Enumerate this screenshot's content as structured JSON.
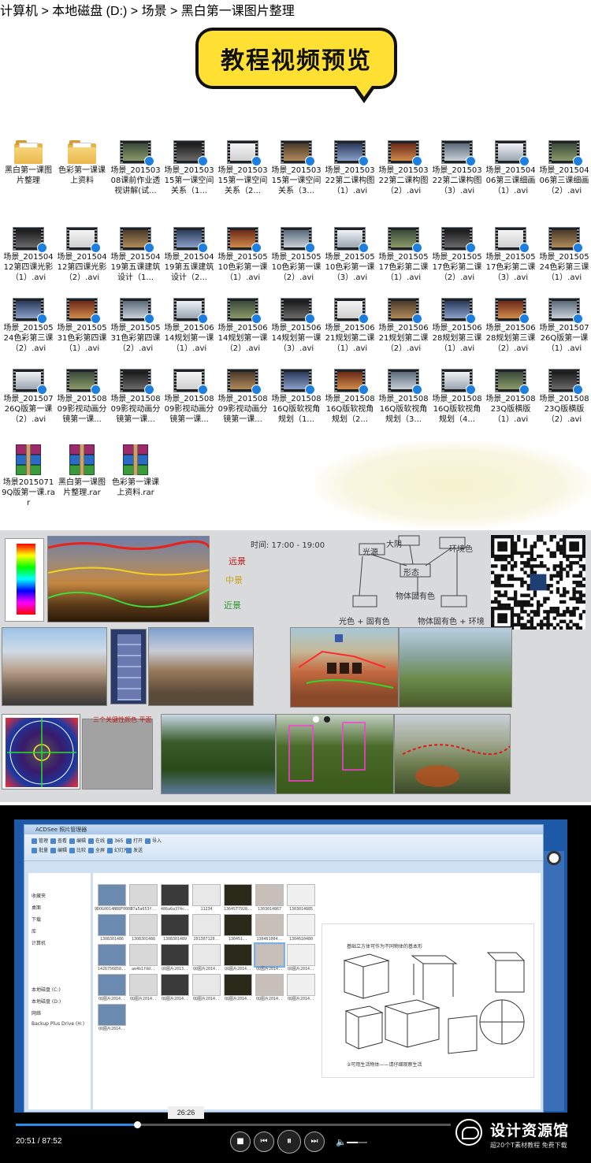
{
  "header": {
    "title": "教程视频预览"
  },
  "files": [
    {
      "label": "黑白第一课图片整理",
      "kind": "folder"
    },
    {
      "label": "色彩第一课课上资料",
      "kind": "folder"
    },
    {
      "label": "场景_20150308课前作业透视讲解(试...",
      "kind": "video"
    },
    {
      "label": "场景_20150315第一课空间关系（1...",
      "kind": "video"
    },
    {
      "label": "场景_20150315第一课空间关系（2...",
      "kind": "video"
    },
    {
      "label": "场景_20150315第一课空间关系（3...",
      "kind": "video"
    },
    {
      "label": "场景_20150322第二课构图（1）.avi",
      "kind": "video"
    },
    {
      "label": "场景_20150322第二课构图（2）.avi",
      "kind": "video"
    },
    {
      "label": "场景_20150322第二课构图（3）.avi",
      "kind": "video"
    },
    {
      "label": "场景_20150406第三课细画（1）.avi",
      "kind": "video"
    },
    {
      "label": "场景_20150406第三课细画（2）.avi",
      "kind": "video"
    },
    {
      "label": "场景_20150412第四课光影（1）.avi",
      "kind": "video"
    },
    {
      "label": "场景_20150412第四课光影（2）.avi",
      "kind": "video"
    },
    {
      "label": "场景_20150419第五课建筑设计（1...",
      "kind": "video"
    },
    {
      "label": "场景_20150419第五课建筑设计（2...",
      "kind": "video"
    },
    {
      "label": "场景_20150510色彩第一课（1）.avi",
      "kind": "video"
    },
    {
      "label": "场景_20150510色彩第一课（2）.avi",
      "kind": "video"
    },
    {
      "label": "场景_20150510色彩第一课（3）.avi",
      "kind": "video"
    },
    {
      "label": "场景_20150517色彩第二课（1）.avi",
      "kind": "video"
    },
    {
      "label": "场景_20150517色彩第二课（2）.avi",
      "kind": "video"
    },
    {
      "label": "场景_20150517色彩第二课（3）.avi",
      "kind": "video"
    },
    {
      "label": "场景_20150524色彩第三课（1）.avi",
      "kind": "video"
    },
    {
      "label": "场景_20150524色彩第三课（2）.avi",
      "kind": "video"
    },
    {
      "label": "场景_20150531色彩第四课（1）.avi",
      "kind": "video"
    },
    {
      "label": "场景_20150531色彩第四课（2）.avi",
      "kind": "video"
    },
    {
      "label": "场景_20150614规划第一课（1）.avi",
      "kind": "video"
    },
    {
      "label": "场景_20150614规划第一课（2）.avi",
      "kind": "video"
    },
    {
      "label": "场景_20150614规划第一课（3）.avi",
      "kind": "video"
    },
    {
      "label": "场景_20150621规划第二课（1）.avi",
      "kind": "video"
    },
    {
      "label": "场景_20150621规划第二课（2）.avi",
      "kind": "video"
    },
    {
      "label": "场景_20150628规划第三课（1）.avi",
      "kind": "video"
    },
    {
      "label": "场景_20150628规划第三课（2）.avi",
      "kind": "video"
    },
    {
      "label": "场景_20150726Q版第一课（1）.avi",
      "kind": "video"
    },
    {
      "label": "场景_20150726Q版第一课（2）.avi",
      "kind": "video"
    },
    {
      "label": "场景_20150809影视动画分镜第一课...",
      "kind": "video"
    },
    {
      "label": "场景_20150809影视动画分镜第一课...",
      "kind": "video"
    },
    {
      "label": "场景_20150809影视动画分镜第一课...",
      "kind": "video"
    },
    {
      "label": "场景_20150809影视动画分镜第一课...",
      "kind": "video"
    },
    {
      "label": "场景_20150816Q版软视角规划（1...",
      "kind": "video"
    },
    {
      "label": "场景_20150816Q版软视角规划（2...",
      "kind": "video"
    },
    {
      "label": "场景_20150816Q版软视角规划（3...",
      "kind": "video"
    },
    {
      "label": "场景_20150816Q版软视角规划（4...",
      "kind": "video"
    },
    {
      "label": "场景_20150823Q版横版（1）.avi",
      "kind": "video"
    },
    {
      "label": "场景_20150823Q版横版（2）.avi",
      "kind": "video"
    },
    {
      "label": "场景20150719Q版第一课.rar",
      "kind": "rar"
    },
    {
      "label": "黑白第一课图片整理.rar",
      "kind": "rar"
    },
    {
      "label": "色彩第一课课上资料.rar",
      "kind": "rar"
    }
  ],
  "painting_panel": {
    "time_note": "时间: 17:00 - 19:00",
    "layer_labels": [
      "远景",
      "中景",
      "近景"
    ],
    "diagram_nodes": [
      "大阴",
      "光源",
      "形态",
      "物体固有色",
      "环境色"
    ],
    "diagram_bottom": [
      "光色 + 固有色",
      "物体固有色 + 环境"
    ],
    "side_note": "三个关键性颜色 平面"
  },
  "player": {
    "window_title": "ACDSee 照片管理器",
    "address": "计算机 > 本地磁盘 (D:) > 场景 > 黑白第一课图片整理",
    "nav_items": [
      "收藏夹",
      "桌面",
      "下载",
      "库",
      "计算机",
      "本地磁盘 (C:)",
      "本地磁盘 (D:)",
      "网络",
      "Backup Plus Drive (H:)"
    ],
    "ribbon_buttons": [
      "管理",
      "查看",
      "编辑",
      "在线",
      "365",
      "打开",
      "导入",
      "批量",
      "编辑",
      "比较",
      "全屏",
      "幻灯片",
      "发送"
    ],
    "thumb_captions": [
      "9DOG0014NB8F0008",
      "37a5a653f..",
      "486a6a374c..",
      "11234",
      "13645T7928..",
      "1303014867",
      "1303014885",
      "1308301486",
      "1308301488",
      "1308301489",
      "201307120..",
      "130451..",
      "130461004..",
      "1304610480",
      "1426756858..",
      "ae4b1fdd..",
      "QQ图片2013..",
      "QQ图片2014..",
      "QQ图片2014..",
      "QQ图片2014..",
      "QQ图片2014..",
      "QQ图片2014..",
      "QQ图片2014..",
      "QQ图片2014..",
      "QQ图片2014..",
      "QQ图片2014..",
      "QQ图片2014..",
      "QQ图片2014..",
      "QQ图片2014.."
    ],
    "preview_title": "基础立方体可作为不同物体的基本形",
    "preview_caption": "②可用生活物体——请仔细观察生活",
    "hover_time": "26:26",
    "time_display": "20:51 / 87:52",
    "progress": 0.2375,
    "volume": 0.55,
    "controls": [
      "■",
      "⏮",
      "⏸",
      "⏭"
    ]
  },
  "brand": {
    "name": "设计资源馆",
    "tagline": "超20个T素材教程 免费下载"
  },
  "colors": {
    "title_yellow": "#ffe033",
    "accent_blue": "#2a8ce6",
    "desktop_blue": "#1e59a8"
  }
}
